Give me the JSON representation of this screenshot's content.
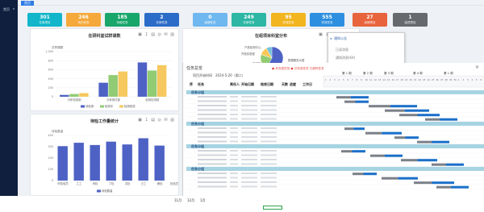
{
  "sidebar": {
    "title": "首页"
  },
  "tabs": {
    "home": "首页"
  },
  "stats": [
    {
      "value": "301",
      "label": "在库项目",
      "color": "#12b5c9"
    },
    {
      "value": "246",
      "label": "待办任务",
      "color": "#f5a93b"
    },
    {
      "value": "185",
      "label": "待验任务",
      "color": "#18a66b"
    },
    {
      "value": "2",
      "label": "在研任务",
      "color": "#2b6cc8"
    },
    {
      "value": "0",
      "label": "延期任务",
      "color": "#6fb7ef"
    },
    {
      "value": "249",
      "label": "在研任务",
      "color": "#2db7a4"
    },
    {
      "value": "95",
      "label": "完成任务",
      "color": "#f2b51f"
    },
    {
      "value": "555",
      "label": "完成任务",
      "color": "#2d8fe0"
    },
    {
      "value": "27",
      "label": "延期项目",
      "color": "#e8643c"
    },
    {
      "value": "1",
      "label": "结项项目",
      "color": "#666a6f"
    }
  ],
  "card1": {
    "title": "在研科室试样课数",
    "tools": "▣ ↧ ▤ ◎ ✉ ▥",
    "chart_data": {
      "type": "bar",
      "ylabel": "试样课数",
      "categories": [
        "分析检验部",
        "分析测试部",
        "检验检测部"
      ],
      "ylim": [
        0,
        1000
      ],
      "yticks": [
        "0",
        "200",
        "400",
        "600",
        "800",
        "1,000"
      ],
      "series": [
        {
          "name": "待检测",
          "color": "#4e62c5",
          "values": [
            40,
            310,
            760
          ]
        },
        {
          "name": "检测中",
          "color": "#91cc75",
          "values": [
            60,
            480,
            580
          ]
        },
        {
          "name": "检测完成",
          "color": "#f6c85f",
          "values": [
            80,
            560,
            700
          ]
        }
      ]
    }
  },
  "card2": {
    "title": "在组项目科室分布",
    "tools": "▣ ↧ ▤ ◎ ✉ ▥",
    "chart_data": {
      "type": "pie",
      "slices": [
        {
          "name": "数据服务大楼",
          "value": 58,
          "color": "#4e62c5"
        },
        {
          "name": "产品检测中心",
          "value": 22,
          "color": "#91cc75"
        },
        {
          "name": "开放实验室",
          "value": 12,
          "color": "#fac858"
        },
        {
          "name": "测试部",
          "value": 8,
          "color": "#73c0de"
        }
      ]
    }
  },
  "card3": {
    "title": "待检工作量统计",
    "tools": "▣ ↧ ▤ ◎ ✉ ▥",
    "chart_data": {
      "type": "bar",
      "ylabel": "待检数量",
      "xlabel": "检验员",
      "categories": [
        "甲检验员",
        "乙工",
        "丙检",
        "丁检",
        "戊检",
        "己工",
        "庚检"
      ],
      "ylim": [
        0,
        400
      ],
      "yticks": [
        "0",
        "100",
        "200",
        "300",
        "400"
      ],
      "series": [
        {
          "name": "待检数量",
          "color": "#4e62c5",
          "values": [
            305,
            335,
            315,
            345,
            320,
            375,
            310
          ]
        }
      ]
    }
  },
  "popup": {
    "title": "通知公告",
    "lines": [
      "已读消息",
      "通知消息(64)",
      "待办消息(Nuli)1002nnnnnnnn"
    ]
  },
  "gantt": {
    "header": "任务总览",
    "close": "×",
    "sub_label": "项目开始时间",
    "sub_value": "2024-5-20（周二）",
    "warn": "● 未完成任务  ● 已完成任务  已超时任务",
    "week_labels": [
      "第 1 周",
      "第 2 周",
      "第 3 周",
      "第 4 周",
      "第 1 周"
    ],
    "columns": [
      "序",
      "任务",
      "责任人",
      "开始日期",
      "结束日期",
      "天数",
      "进度",
      "工作日"
    ],
    "groups": [
      {
        "label": "任务分组",
        "rows": 6
      },
      {
        "label": "任务分组",
        "rows": 4
      },
      {
        "label": "任务分组",
        "rows": 4
      },
      {
        "label": "任务分组",
        "rows": 4
      }
    ]
  },
  "bottom": {
    "labels": [
      "11月",
      "12月",
      "1月"
    ]
  }
}
